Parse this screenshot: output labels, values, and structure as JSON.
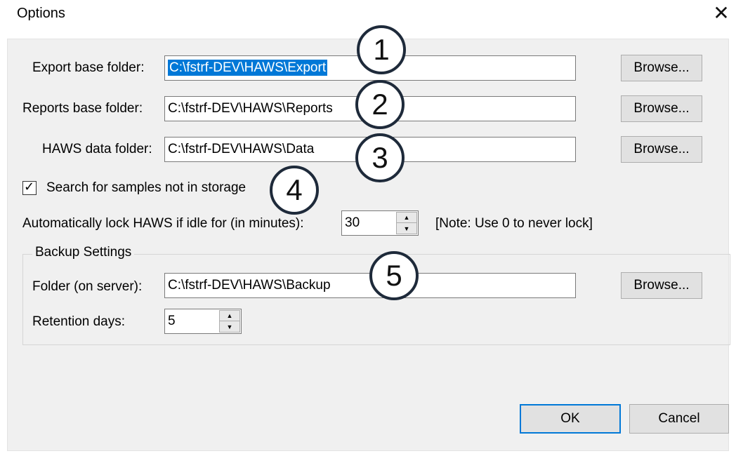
{
  "window": {
    "title": "Options",
    "close_glyph": "✕"
  },
  "fields": {
    "export": {
      "label": "Export base folder:",
      "value": "C:\\fstrf-DEV\\HAWS\\Export",
      "browse_label": "Browse..."
    },
    "reports": {
      "label": "Reports base folder:",
      "value": "C:\\fstrf-DEV\\HAWS\\Reports",
      "browse_label": "Browse..."
    },
    "data": {
      "label": "HAWS data folder:",
      "value": "C:\\fstrf-DEV\\HAWS\\Data",
      "browse_label": "Browse..."
    }
  },
  "search_samples": {
    "label": "Search for samples not in storage",
    "checked": true,
    "check_glyph": "✓"
  },
  "auto_lock": {
    "label": "Automatically lock HAWS if idle for (in minutes):",
    "value": "30",
    "note": "[Note: Use 0 to never lock]"
  },
  "backup": {
    "group_title": "Backup Settings",
    "folder_label": "Folder (on server):",
    "folder_value": "C:\\fstrf-DEV\\HAWS\\Backup",
    "browse_label": "Browse...",
    "retention_label": "Retention days:",
    "retention_value": "5"
  },
  "spinner_glyphs": {
    "up": "▲",
    "down": "▼"
  },
  "buttons": {
    "ok": "OK",
    "cancel": "Cancel"
  },
  "callouts": [
    "1",
    "2",
    "3",
    "4",
    "5"
  ],
  "colors": {
    "selection": "#0078d7",
    "dialog_bg": "#f0f0f0",
    "callout_border": "#1e2a3a"
  }
}
